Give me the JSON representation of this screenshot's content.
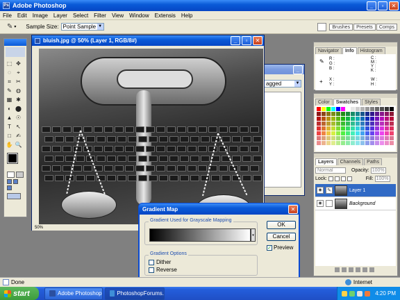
{
  "app": {
    "title": "Adobe Photoshop",
    "menus": [
      "File",
      "Edit",
      "Image",
      "Layer",
      "Select",
      "Filter",
      "View",
      "Window",
      "Extensis",
      "Help"
    ],
    "options_bar": {
      "sample_size_label": "Sample Size:",
      "sample_size_value": "Point Sample",
      "palette_tabs": [
        "Brushes",
        "Presets",
        "Comps"
      ]
    }
  },
  "document": {
    "title": "bluish.jpg @ 50% (Layer 1, RGB/8#)",
    "zoom_status": "50%"
  },
  "behind_window": {
    "dropdown_value": "agged"
  },
  "navigator_panel": {
    "tabs": [
      "Navigator",
      "Info",
      "Histogram"
    ],
    "active_tab": "Info",
    "left_labels": [
      "R :",
      "G :",
      "B :"
    ],
    "right_labels": [
      "C :",
      "M :",
      "Y :",
      "K :"
    ],
    "xy_labels": [
      "X :",
      "Y :"
    ],
    "wh_labels": [
      "W :",
      "H :"
    ]
  },
  "swatches_panel": {
    "tabs": [
      "Color",
      "Swatches",
      "Styles"
    ],
    "active_tab": "Swatches"
  },
  "layers_panel": {
    "tabs": [
      "Layers",
      "Channels",
      "Paths"
    ],
    "active_tab": "Layers",
    "blend_mode": "Normal",
    "opacity_label": "Opacity:",
    "opacity_value": "100%",
    "lock_label": "Lock:",
    "fill_label": "Fill:",
    "fill_value": "100%",
    "layers": [
      {
        "name": "Layer 1",
        "selected": true
      },
      {
        "name": "Background",
        "selected": false
      }
    ]
  },
  "dialog": {
    "title": "Gradient Map",
    "group1_label": "Gradient Used for Grayscale Mapping",
    "group2_label": "Gradient Options",
    "dither_label": "Dither",
    "reverse_label": "Reverse",
    "preview_label": "Preview",
    "preview_checked": true,
    "ok_label": "OK",
    "cancel_label": "Cancel"
  },
  "statusbar": {
    "left": "Done",
    "right": "Internet"
  },
  "taskbar": {
    "start_label": "start",
    "tasks": [
      "Adobe Photoshop",
      "PhotoshopForums.co..."
    ],
    "clock": "4:20 PM"
  },
  "colors": {
    "xp_blue": "#0a5ad8",
    "panel_bg": "#ece9d8",
    "selected_layer": "#316ac5",
    "taskbar": "#245edb",
    "start_green": "#3c9c3c"
  }
}
